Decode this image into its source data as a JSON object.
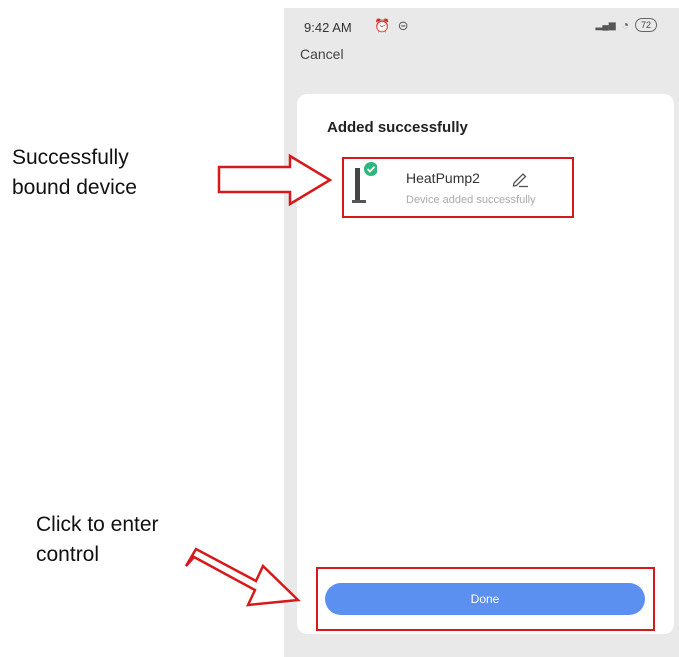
{
  "annotations": {
    "bound_device_line1": "Successfully",
    "bound_device_line2": "bound device",
    "click_line1": "Click to enter",
    "click_line2": "control"
  },
  "status_bar": {
    "time": "9:42 AM",
    "left_icons": [
      "alarm-icon",
      "circle-status-icon"
    ],
    "left_glyphs": "⏰ ⊝",
    "signal_glyph": "▂▄▆",
    "wifi_glyph": "◔",
    "battery": "72"
  },
  "header": {
    "cancel_label": "Cancel"
  },
  "card": {
    "title": "Added successfully",
    "device": {
      "name": "HeatPump2",
      "status": "Device added successfully",
      "icon": "heat-pump-device-icon",
      "badge_color": "#2fb67c"
    },
    "done_label": "Done"
  },
  "colors": {
    "accent_button": "#5b8ff0",
    "annotation_red": "#d6191b",
    "success_green": "#2fb67c"
  }
}
